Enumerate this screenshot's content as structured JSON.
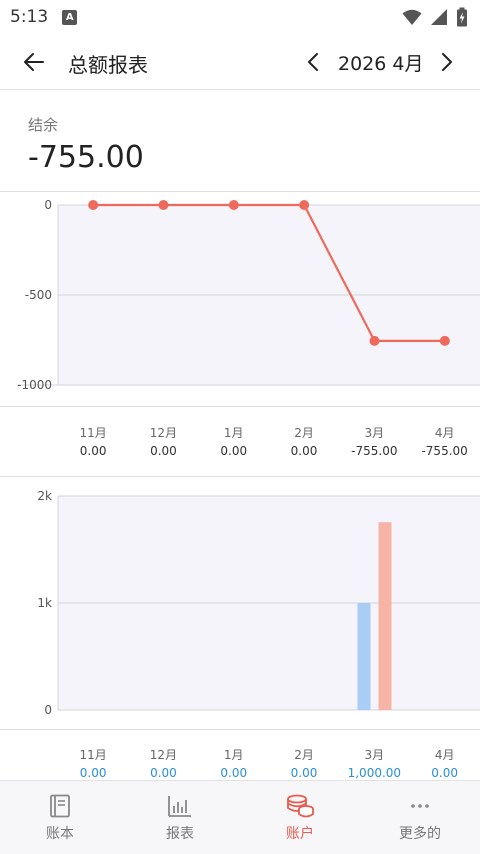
{
  "status": {
    "time": "5:13",
    "badge": "A"
  },
  "header": {
    "title": "总额报表",
    "period": "2026 4月"
  },
  "balance": {
    "label": "结余",
    "value": "-755.00"
  },
  "colors": {
    "accent": "#e85d4f",
    "line": "#ee6a5c",
    "income": "#a9cdf5",
    "expense": "#f7b3a6",
    "grid": "#d4d4dc",
    "plotBg": "#f5f4fa"
  },
  "chart_data": [
    {
      "type": "line",
      "categories": [
        "11月",
        "12月",
        "1月",
        "2月",
        "3月",
        "4月"
      ],
      "values": [
        0,
        0,
        0,
        0,
        -755,
        -755
      ],
      "ylim": [
        -1000,
        0
      ],
      "yticks": [
        "0",
        "-500",
        "-1000"
      ],
      "value_labels": [
        "0.00",
        "0.00",
        "0.00",
        "0.00",
        "-755.00",
        "-755.00"
      ],
      "grid": true
    },
    {
      "type": "bar",
      "categories": [
        "11月",
        "12月",
        "1月",
        "2月",
        "3月",
        "4月"
      ],
      "series": [
        {
          "values": [
            0,
            0,
            0,
            0,
            1000,
            0
          ],
          "color": "#a9cdf5"
        },
        {
          "values": [
            0,
            0,
            0,
            0,
            1755,
            0
          ],
          "color": "#f7b3a6"
        }
      ],
      "ylim": [
        0,
        2000
      ],
      "yticks": [
        "2k",
        "1k",
        "0"
      ],
      "value_labels": [
        "0.00",
        "0.00",
        "0.00",
        "0.00",
        "1,000.00",
        "0.00"
      ],
      "grid": true
    }
  ],
  "nav": [
    {
      "label": "账本",
      "icon": "book-icon"
    },
    {
      "label": "报表",
      "icon": "bar-chart-icon"
    },
    {
      "label": "账户",
      "icon": "coins-icon"
    },
    {
      "label": "更多的",
      "icon": "more-icon"
    }
  ]
}
